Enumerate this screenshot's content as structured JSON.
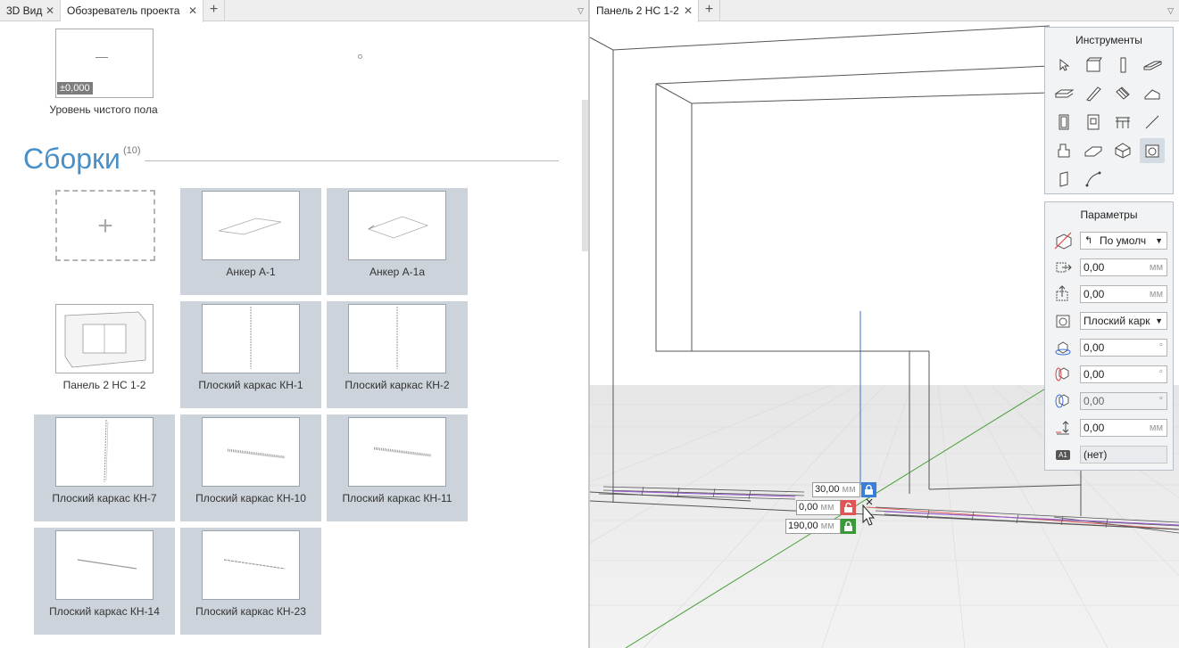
{
  "left_tabs": {
    "tab1": "3D Вид",
    "tab2": "Обозреватель проекта",
    "close": "✕",
    "add": "+",
    "menu": "▽"
  },
  "right_tabs": {
    "tab1": "Панель 2 НС 1-2",
    "close": "✕",
    "add": "+",
    "menu": "▽"
  },
  "level": {
    "badge": "±0,000",
    "caption": "Уровень чистого пола"
  },
  "section": {
    "title": "Сборки",
    "count": "(10)",
    "add": "+"
  },
  "assemblies": [
    {
      "label": "Анкер А-1"
    },
    {
      "label": "Анкер А-1а"
    },
    {
      "label": "Панель 2 НС 1-2"
    },
    {
      "label": "Плоский каркас КН-1"
    },
    {
      "label": "Плоский каркас КН-2"
    },
    {
      "label": "Плоский каркас КН-7"
    },
    {
      "label": "Плоский каркас КН-10"
    },
    {
      "label": "Плоский каркас КН-11"
    },
    {
      "label": "Плоский каркас КН-14"
    },
    {
      "label": "Плоский каркас КН-23"
    }
  ],
  "tools_panel": {
    "title": "Инструменты"
  },
  "params_panel": {
    "title": "Параметры",
    "mode": "По умолч",
    "offset_x": "0,00",
    "offset_y": "0,00",
    "unit_mm": "мм",
    "type": "Плоский карк",
    "rot1": "0,00",
    "rot2": "0,00",
    "rot3": "0,00",
    "unit_deg": "°",
    "height": "0,00",
    "tag_icon": "A1",
    "tag": "(нет)",
    "dropdown_arrow": "▼"
  },
  "dimensions": {
    "d1": "30,00",
    "d2": "0,00",
    "d3": "190,00",
    "unit": "мм"
  },
  "colors": {
    "accent": "#4a90c8",
    "card_bg": "#ccd3da",
    "lock_blue": "#3a7fd5",
    "lock_red": "#e05555",
    "lock_green": "#3a9a3a"
  }
}
